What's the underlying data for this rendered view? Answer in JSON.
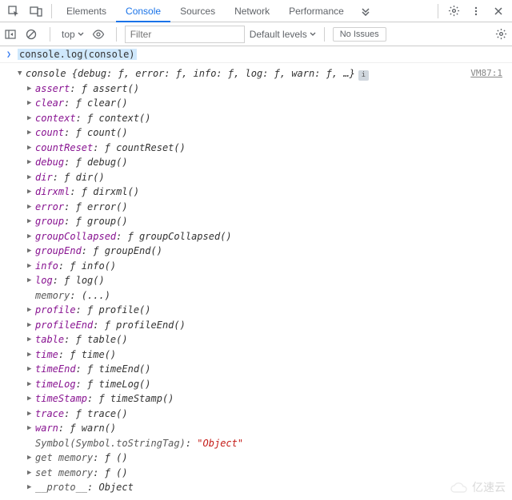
{
  "tabs": [
    "Elements",
    "Console",
    "Sources",
    "Network",
    "Performance"
  ],
  "activeTab": "Console",
  "toolbar": {
    "context": "top",
    "filter_placeholder": "Filter",
    "levels": "Default levels",
    "no_issues": "No Issues"
  },
  "command": "console.log(console)",
  "source_ref": "VM87:1",
  "summary": "console {debug: ƒ, error: ƒ, info: ƒ, log: ƒ, warn: ƒ, …}",
  "props": [
    {
      "name": "assert",
      "val": "ƒ assert()",
      "tri": "right"
    },
    {
      "name": "clear",
      "val": "ƒ clear()",
      "tri": "right"
    },
    {
      "name": "context",
      "val": "ƒ context()",
      "tri": "right"
    },
    {
      "name": "count",
      "val": "ƒ count()",
      "tri": "right"
    },
    {
      "name": "countReset",
      "val": "ƒ countReset()",
      "tri": "right"
    },
    {
      "name": "debug",
      "val": "ƒ debug()",
      "tri": "right"
    },
    {
      "name": "dir",
      "val": "ƒ dir()",
      "tri": "right"
    },
    {
      "name": "dirxml",
      "val": "ƒ dirxml()",
      "tri": "right"
    },
    {
      "name": "error",
      "val": "ƒ error()",
      "tri": "right"
    },
    {
      "name": "group",
      "val": "ƒ group()",
      "tri": "right"
    },
    {
      "name": "groupCollapsed",
      "val": "ƒ groupCollapsed()",
      "tri": "right"
    },
    {
      "name": "groupEnd",
      "val": "ƒ groupEnd()",
      "tri": "right"
    },
    {
      "name": "info",
      "val": "ƒ info()",
      "tri": "right"
    },
    {
      "name": "log",
      "val": "ƒ log()",
      "tri": "right"
    },
    {
      "name": "memory",
      "val": "(...)",
      "tri": "none",
      "gray": true
    },
    {
      "name": "profile",
      "val": "ƒ profile()",
      "tri": "right"
    },
    {
      "name": "profileEnd",
      "val": "ƒ profileEnd()",
      "tri": "right"
    },
    {
      "name": "table",
      "val": "ƒ table()",
      "tri": "right"
    },
    {
      "name": "time",
      "val": "ƒ time()",
      "tri": "right"
    },
    {
      "name": "timeEnd",
      "val": "ƒ timeEnd()",
      "tri": "right"
    },
    {
      "name": "timeLog",
      "val": "ƒ timeLog()",
      "tri": "right"
    },
    {
      "name": "timeStamp",
      "val": "ƒ timeStamp()",
      "tri": "right"
    },
    {
      "name": "trace",
      "val": "ƒ trace()",
      "tri": "right"
    },
    {
      "name": "warn",
      "val": "ƒ warn()",
      "tri": "right"
    },
    {
      "name": "Symbol(Symbol.toStringTag)",
      "val": "\"Object\"",
      "tri": "none",
      "gray": true,
      "string": true
    },
    {
      "name": "get memory",
      "val": "ƒ ()",
      "tri": "right",
      "gray": true
    },
    {
      "name": "set memory",
      "val": "ƒ ()",
      "tri": "right",
      "gray": true
    },
    {
      "name": "__proto__",
      "val": "Object",
      "tri": "right",
      "gray": true
    }
  ],
  "watermark": "亿速云"
}
